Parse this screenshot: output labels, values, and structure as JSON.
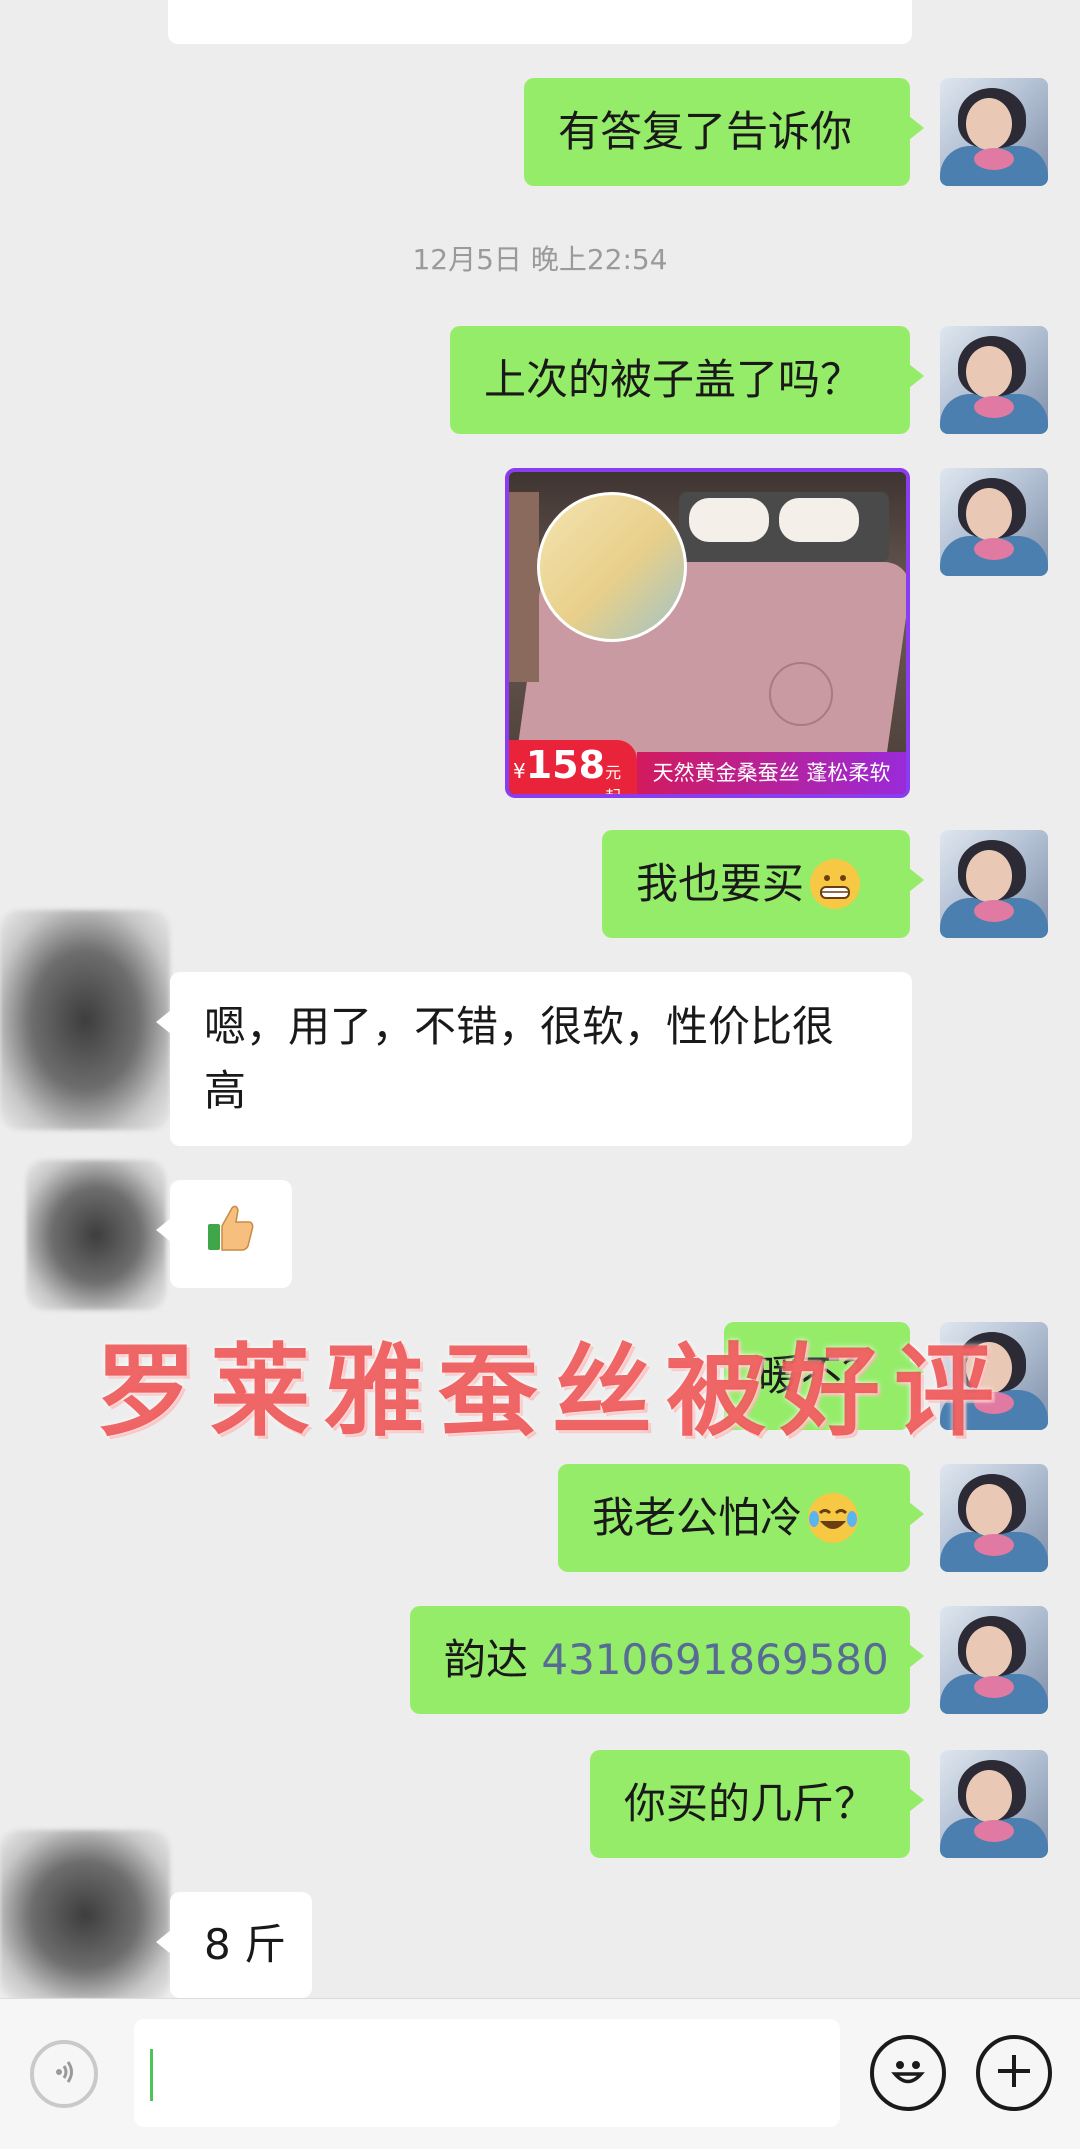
{
  "chat": {
    "timestamp": "12月5日 晚上22:54",
    "messages": [
      {
        "from": "me",
        "text": "有答复了告诉你"
      },
      {
        "from": "me",
        "text": "上次的被子盖了吗？"
      },
      {
        "from": "me",
        "type": "product_card",
        "price_symbol": "¥",
        "price": "158",
        "price_suffix": "元起",
        "caption": "天然黄金桑蚕丝 蓬松柔软"
      },
      {
        "from": "me",
        "text": "我也要买",
        "emoji": "grinning-face"
      },
      {
        "from": "them",
        "text_line1": "嗯，用了，不错，很软，性价比很",
        "text_line2": "高"
      },
      {
        "from": "them",
        "emoji": "thumbs-up"
      },
      {
        "from": "me",
        "text": "暖不？"
      },
      {
        "from": "me",
        "text": "我老公怕冷",
        "emoji": "tears-of-joy"
      },
      {
        "from": "me",
        "prefix": "韵达 ",
        "tracking_number": "4310691869580"
      },
      {
        "from": "me",
        "text": "你买的几斤？"
      },
      {
        "from": "them",
        "text": "8 斤"
      }
    ]
  },
  "watermark": "罗莱雅蚕丝被好评",
  "colors": {
    "background": "#ededed",
    "my_bubble": "#95ec69",
    "their_bubble": "#ffffff",
    "link": "#576b95",
    "watermark": "#eb4646"
  },
  "input_bar": {
    "voice_icon": "voice-icon",
    "emoji_icon": "smile-icon",
    "plus_icon": "plus-icon"
  }
}
